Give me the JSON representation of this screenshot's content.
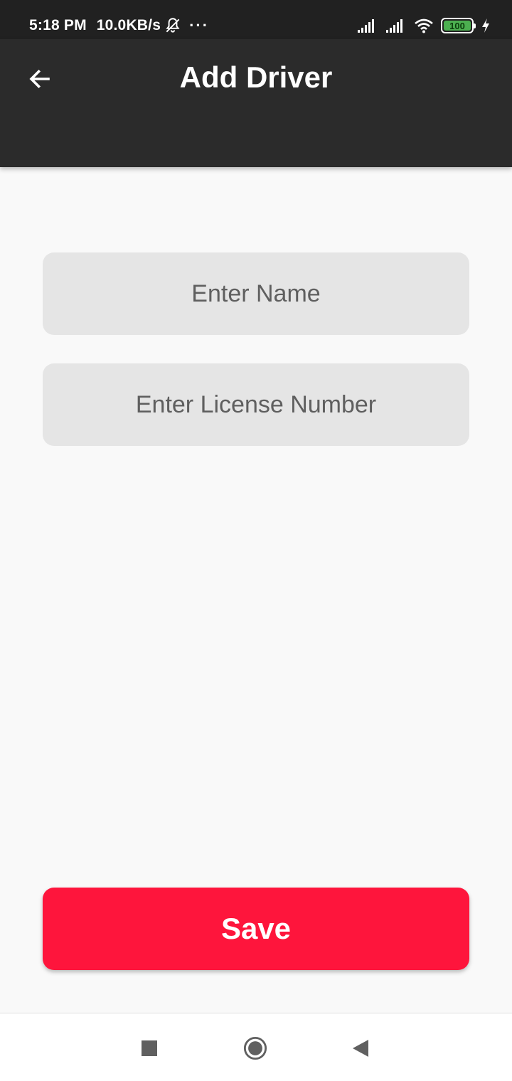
{
  "status_bar": {
    "time": "5:18 PM",
    "network_speed": "10.0KB/s",
    "more": "···",
    "battery_level": "100",
    "icons": [
      "muted-bell-icon",
      "signal-icon",
      "signal-icon",
      "wifi-icon",
      "battery-icon",
      "charging-bolt-icon"
    ],
    "battery_color": "#4caf50"
  },
  "app_bar": {
    "title": "Add Driver",
    "back_icon": "arrow-left-icon",
    "background": "#2b2b2b"
  },
  "form": {
    "name_placeholder": "Enter Name",
    "name_value": "",
    "license_placeholder": "Enter License Number",
    "license_value": ""
  },
  "actions": {
    "save_label": "Save",
    "save_color": "#fe153c"
  },
  "nav_bar": {
    "icons": [
      "recents-square-icon",
      "home-circle-icon",
      "back-triangle-icon"
    ]
  }
}
